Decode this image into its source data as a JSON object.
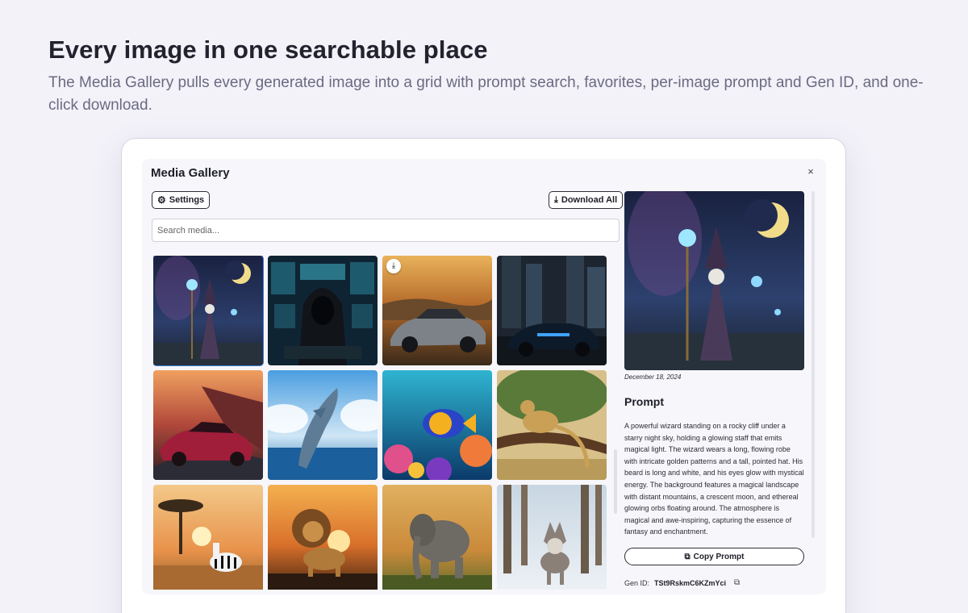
{
  "hero": {
    "title": "Every image in one searchable place",
    "subtitle": "The Media Gallery pulls every generated image into a grid with prompt search, favorites, per-image prompt and Gen ID, and one-click download."
  },
  "modal": {
    "title": "Media Gallery",
    "close_icon": "×"
  },
  "toolbar": {
    "settings_label": "Settings",
    "settings_icon": "⚙",
    "download_all_label": "Download All",
    "download_icon": "⤓"
  },
  "search": {
    "placeholder": "Search media...",
    "value": ""
  },
  "gallery": {
    "selected_index": 0,
    "items": [
      {
        "subject": "wizard",
        "icon": "wizard-image"
      },
      {
        "subject": "hacker",
        "icon": "hacker-image"
      },
      {
        "subject": "silver sports car",
        "icon": "car-image",
        "download_icon": "⤓"
      },
      {
        "subject": "supercar city night",
        "icon": "supercar-image"
      },
      {
        "subject": "red concept car",
        "icon": "red-car-image"
      },
      {
        "subject": "dolphin",
        "icon": "dolphin-image"
      },
      {
        "subject": "tropical fish coral reef",
        "icon": "fish-image"
      },
      {
        "subject": "leopard on tree",
        "icon": "leopard-image"
      },
      {
        "subject": "zebra savanna",
        "icon": "zebra-image"
      },
      {
        "subject": "lion sunset",
        "icon": "lion-image"
      },
      {
        "subject": "elephant",
        "icon": "elephant-image"
      },
      {
        "subject": "wolf snowy forest",
        "icon": "wolf-image"
      }
    ]
  },
  "detail": {
    "date": "December 18, 2024",
    "prompt_heading": "Prompt",
    "prompt_text": "A powerful wizard standing on a rocky cliff under a starry night sky, holding a glowing staff that emits magical light. The wizard wears a long, flowing robe with intricate golden patterns and a tall, pointed hat. His beard is long and white, and his eyes glow with mystical energy. The background features a magical landscape with distant mountains, a crescent moon, and ethereal glowing orbs floating around. The atmosphere is magical and awe-inspiring, capturing the essence of fantasy and enchantment.",
    "copy_prompt_label": "Copy Prompt",
    "copy_icon": "⧉",
    "gen_id_label": "Gen ID:",
    "gen_id_value": "TSt9RskmC6KZmYci"
  },
  "colors": {
    "page_bg": "#f3f2f9",
    "accent_selected": "#3b7bd6",
    "text_dark": "#23232f",
    "text_muted": "#6b6a82"
  }
}
